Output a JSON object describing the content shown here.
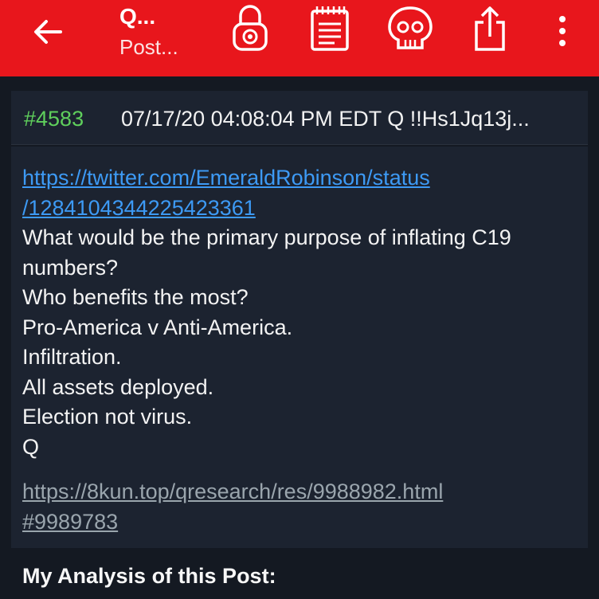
{
  "toolbar": {
    "title": "Q...",
    "subtitle": "Post...",
    "icons": [
      "back-arrow-icon",
      "lock-icon",
      "notepad-icon",
      "skull-icon",
      "share-icon",
      "overflow-menu-icon"
    ],
    "accent": "#e8161c"
  },
  "post": {
    "number": "#4583",
    "meta": "07/17/20 04:08:04 PM EDT Q !!Hs1Jq13j...",
    "link_line1": "https://twitter.com/EmeraldRobinson/status",
    "link_line2": "/1284104344225423361",
    "lines": [
      "What would be the primary purpose of inflating C19",
      "numbers?",
      "Who benefits the most?",
      "Pro-America v Anti-America.",
      "Infiltration.",
      "All assets deployed.",
      "Election not virus.",
      "Q"
    ],
    "source_line1": "https://8kun.top/qresearch/res/9988982.html",
    "source_line2": "#9989783"
  },
  "analysis_heading": "My Analysis of this Post:"
}
